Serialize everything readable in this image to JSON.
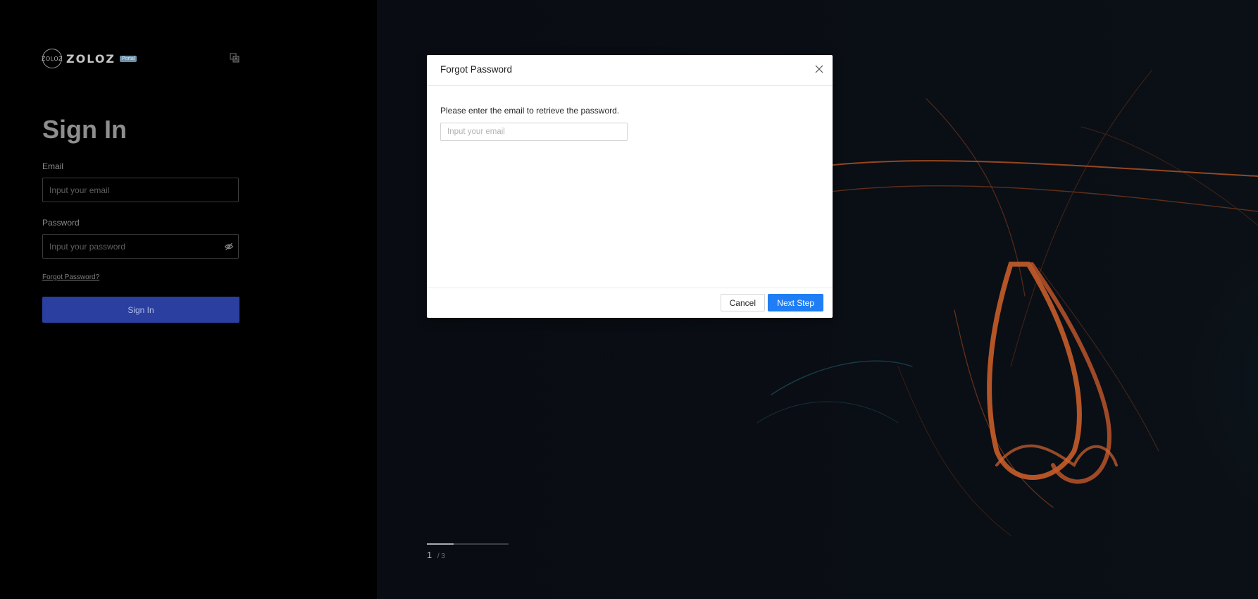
{
  "brand": {
    "logo_mark": "ZOLOZ",
    "name": "ZOLOZ",
    "tag": "Portal"
  },
  "icons": {
    "language": "translate-icon",
    "password_toggle": "eye-off-icon",
    "close": "close-icon"
  },
  "signin": {
    "title": "Sign In",
    "email_label": "Email",
    "email_placeholder": "Input your email",
    "email_value": "",
    "password_label": "Password",
    "password_placeholder": "Input your password",
    "password_value": "",
    "forgot_link": "Forgot Password?",
    "button": "Sign In"
  },
  "carousel": {
    "current": "1",
    "total": "/ 3",
    "progress": 0.33
  },
  "modal": {
    "title": "Forgot Password",
    "instruction": "Please enter the email to retrieve the password.",
    "email_placeholder": "Input your email",
    "email_value": "",
    "cancel": "Cancel",
    "next": "Next Step"
  },
  "colors": {
    "primary": "#1f7ef5",
    "signin_button": "#2a3fa0",
    "background": "#000000"
  }
}
